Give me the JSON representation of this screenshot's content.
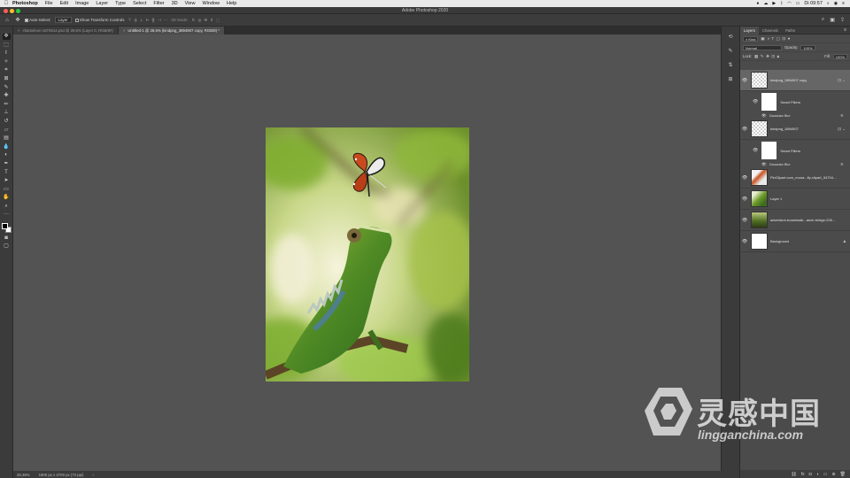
{
  "menubar": {
    "app_name": "Photoshop",
    "items": [
      "File",
      "Edit",
      "Image",
      "Layer",
      "Type",
      "Select",
      "Filter",
      "3D",
      "View",
      "Window",
      "Help"
    ],
    "clock": "Di 09:57"
  },
  "window": {
    "title": "Adobe Photoshop 2020"
  },
  "options": {
    "auto_select_label": "Auto-Select:",
    "auto_select_target": "Layer",
    "show_transform_label": "Show Transform Controls",
    "mode_label": "3D Mode:"
  },
  "tabs": [
    {
      "label": "chameleon-1874514.psd @ 28,6% (Layer 0, RGB/8#)",
      "active": false
    },
    {
      "label": "Untitled-1 @ 28,6% (kindpng_3894907 copy, RGB/8) *",
      "active": true
    }
  ],
  "status": {
    "zoom": "28,38%",
    "doc_info": "1900 px x 2700 px (72 ppi)"
  },
  "layers_panel": {
    "tabs": [
      "Layers",
      "Channels",
      "Paths"
    ],
    "filter_kind": "Kind",
    "blend_mode": "Normal",
    "opacity_label": "Opacity:",
    "opacity_value": "100%",
    "lock_label": "Lock:",
    "fill_label": "Fill:",
    "fill_value": "100%",
    "layers": [
      {
        "name": "kindpng_3894907 copy",
        "selected": true,
        "thumb": "butterfly-checker",
        "smart_filters": "Smart Filters",
        "filter": "Gaussian Blur"
      },
      {
        "name": "kindpng_3894907",
        "selected": false,
        "thumb": "butterfly-checker",
        "smart_filters": "Smart Filters",
        "filter": "Gaussian Blur"
      },
      {
        "name": "PinClipart.com_mona...fly-clipart_3470438",
        "selected": false,
        "thumb": "butterfly"
      },
      {
        "name": "Layer 1",
        "selected": false,
        "thumb": "chameleon"
      },
      {
        "name": "adventure-boardwalk...anch-bridge-226631",
        "selected": false,
        "thumb": "forest"
      },
      {
        "name": "Background",
        "selected": false,
        "thumb": "white"
      }
    ]
  },
  "watermark": {
    "cn_text": "灵感中国",
    "url": "lingganchina.com"
  }
}
